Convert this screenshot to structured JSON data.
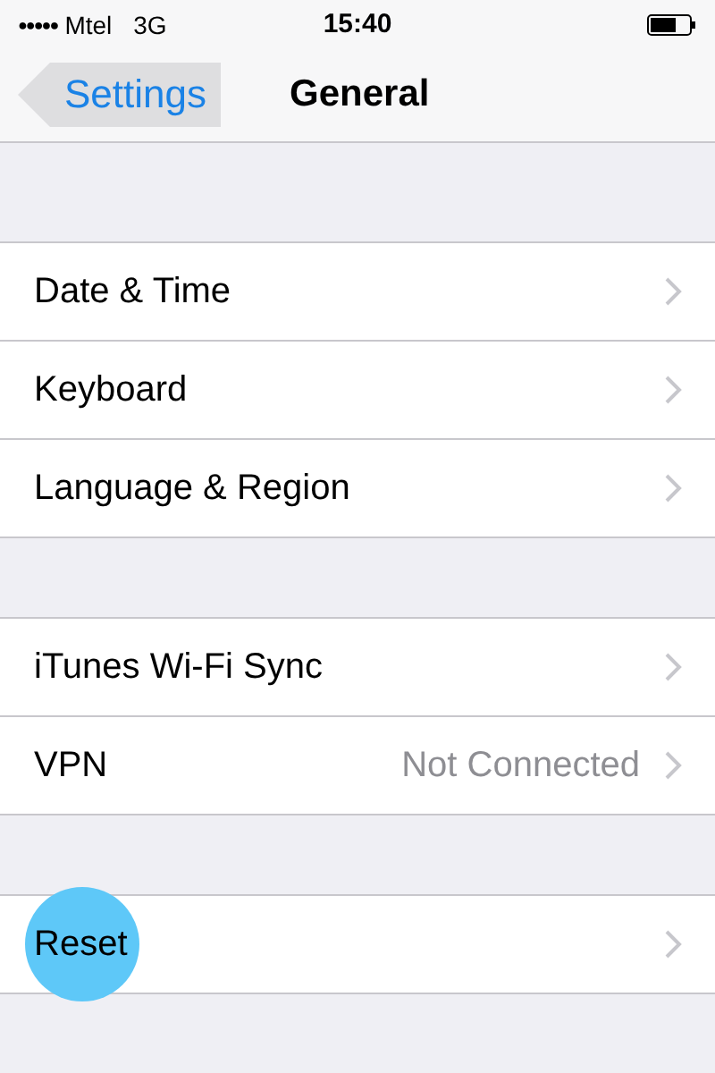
{
  "status_bar": {
    "signal_dots": "●●●●●",
    "carrier": "Mtel",
    "network": "3G",
    "time": "15:40"
  },
  "nav": {
    "back": {
      "label": "Settings",
      "highlighted": true
    },
    "title": "General"
  },
  "sections": [
    {
      "rows": [
        {
          "label": "Date & Time",
          "highlighted": false
        },
        {
          "label": "Keyboard",
          "highlighted": false
        },
        {
          "label": "Language & Region",
          "highlighted": false
        }
      ]
    },
    {
      "rows": [
        {
          "label": "iTunes Wi-Fi Sync",
          "highlighted": false
        },
        {
          "label": "VPN",
          "value": "Not Connected",
          "highlighted": false
        }
      ]
    },
    {
      "rows": [
        {
          "label": "Reset",
          "highlighted": true
        }
      ]
    }
  ]
}
